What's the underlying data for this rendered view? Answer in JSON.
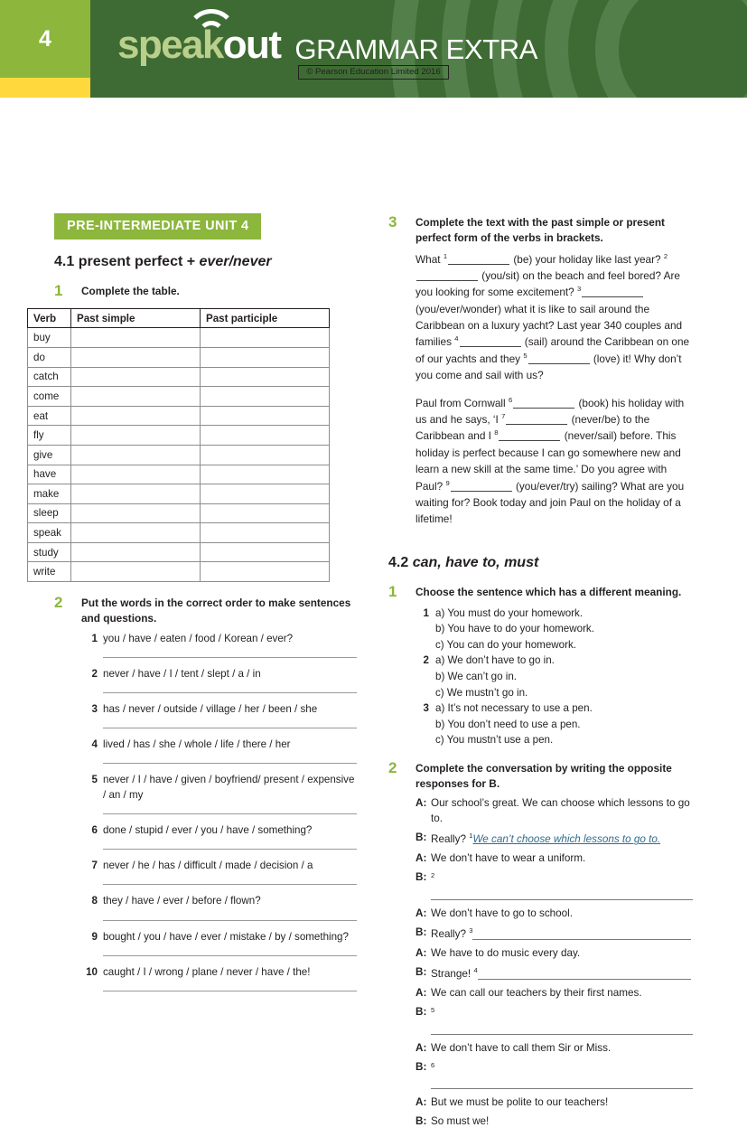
{
  "header": {
    "unit_number": "4",
    "logo_part1": "speak",
    "logo_part2": "out",
    "title": "GRAMMAR EXTRA",
    "colors": {
      "dark_green": "#3e6b33",
      "arc_green": "#53804a",
      "lime": "#8cb63c",
      "yellow": "#ffd83d"
    }
  },
  "left": {
    "banner": "PRE-INTERMEDIATE UNIT 4",
    "grammar_heading": {
      "code": "4.1",
      "text_plain": "present perfect + ",
      "text_italic": "ever/never"
    },
    "ex1": {
      "number": "1",
      "rubric": "Complete the table.",
      "table": {
        "headers": [
          "Verb",
          "Past simple",
          "Past participle"
        ],
        "rows": [
          [
            "buy",
            "",
            ""
          ],
          [
            "do",
            "",
            ""
          ],
          [
            "catch",
            "",
            ""
          ],
          [
            "come",
            "",
            ""
          ],
          [
            "eat",
            "",
            ""
          ],
          [
            "fly",
            "",
            ""
          ],
          [
            "give",
            "",
            ""
          ],
          [
            "have",
            "",
            ""
          ],
          [
            "make",
            "",
            ""
          ],
          [
            "sleep",
            "",
            ""
          ],
          [
            "speak",
            "",
            ""
          ],
          [
            "study",
            "",
            ""
          ],
          [
            "write",
            "",
            ""
          ]
        ]
      }
    },
    "ex2": {
      "number": "2",
      "rubric": "Put the words in the correct order to make sentences and questions.",
      "items": [
        {
          "n": "1",
          "text": "you / have / eaten / food / Korean / ever?"
        },
        {
          "n": "2",
          "text": "never / have / I / tent / slept / a / in"
        },
        {
          "n": "3",
          "text": "has / never / outside / village / her / been / she"
        },
        {
          "n": "4",
          "text": "lived / has / she / whole / life / there / her"
        },
        {
          "n": "5",
          "text": "never / I / have / given / boyfriend/ present / expensive / an / my"
        },
        {
          "n": "6",
          "text": "done / stupid / ever / you / have / something?"
        },
        {
          "n": "7",
          "text": "never / he / has / difficult / made / decision / a"
        },
        {
          "n": "8",
          "text": "they / have / ever / before / flown?"
        },
        {
          "n": "9",
          "text": "bought / you / have / ever / mistake / by / something?"
        },
        {
          "n": "10",
          "text": "caught / I / wrong / plane / never / have / the!"
        }
      ]
    }
  },
  "right": {
    "ex3": {
      "number": "3",
      "rubric": "Complete the text with the past simple or present perfect form of the verbs in brackets.",
      "paragraph1": [
        {
          "t": "text",
          "v": "What "
        },
        {
          "t": "sup",
          "v": "1"
        },
        {
          "t": "gap"
        },
        {
          "t": "text",
          "v": " (be) your holiday like last year? "
        },
        {
          "t": "sup",
          "v": "2"
        },
        {
          "t": "gap"
        },
        {
          "t": "text",
          "v": " (you/sit) on the beach and feel bored? Are you looking for some excitement? "
        },
        {
          "t": "sup",
          "v": "3"
        },
        {
          "t": "gap"
        },
        {
          "t": "text",
          "v": " (you/ever/wonder) what it is like to sail around the Caribbean on a luxury yacht? Last year 340 couples and families "
        },
        {
          "t": "sup",
          "v": "4"
        },
        {
          "t": "gap"
        },
        {
          "t": "text",
          "v": " (sail) around the Caribbean on one of our yachts and they "
        },
        {
          "t": "sup",
          "v": "5"
        },
        {
          "t": "gap"
        },
        {
          "t": "text",
          "v": " (love) it! Why don’t you come and sail with us?"
        }
      ],
      "paragraph2": [
        {
          "t": "text",
          "v": "Paul from Cornwall "
        },
        {
          "t": "sup",
          "v": "6"
        },
        {
          "t": "gap"
        },
        {
          "t": "text",
          "v": " (book) his holiday with us and he says, ‘I "
        },
        {
          "t": "sup",
          "v": "7"
        },
        {
          "t": "gap"
        },
        {
          "t": "text",
          "v": " (never/be) to the Caribbean and I "
        },
        {
          "t": "sup",
          "v": "8"
        },
        {
          "t": "gap"
        },
        {
          "t": "text",
          "v": " (never/sail) before. This holiday is perfect because I can go somewhere new and learn a new skill at the same time.’ Do you agree with Paul? "
        },
        {
          "t": "sup",
          "v": "9"
        },
        {
          "t": "gap"
        },
        {
          "t": "text",
          "v": " (you/ever/try) sailing? What are you waiting for? Book today and join Paul on the holiday of a lifetime!"
        }
      ]
    },
    "grammar_heading": {
      "code": "4.2",
      "text_italic": "can, have to, must"
    },
    "ex1": {
      "number": "1",
      "rubric": "Choose the sentence which has a different meaning.",
      "items": [
        {
          "n": "1",
          "options": [
            "a) You must do your homework.",
            "b) You have to do your homework.",
            "c) You can do your homework."
          ]
        },
        {
          "n": "2",
          "options": [
            "a) We don’t have to go in.",
            "b) We can’t go in.",
            "c) We mustn’t go in."
          ]
        },
        {
          "n": "3",
          "options": [
            "a) It’s not necessary to use a pen.",
            "b) You don’t need to use a pen.",
            "c) You mustn’t use a pen."
          ]
        }
      ]
    },
    "ex2": {
      "number": "2",
      "rubric": "Complete the conversation by writing the opposite responses for B.",
      "lines": [
        {
          "speaker": "A:",
          "text": "Our school’s great. We can choose which lessons to go to.",
          "blank": false
        },
        {
          "speaker": "B:",
          "text": "Really? ",
          "sup": "1",
          "sample": "We can’t choose which lessons to go to.",
          "blank": false
        },
        {
          "speaker": "A:",
          "text": "We don’t have to wear a uniform.",
          "blank": false
        },
        {
          "speaker": "B:",
          "text": "",
          "sup": "2",
          "blank": true
        },
        {
          "speaker": "A:",
          "text": "We don’t have to go to school.",
          "blank": false
        },
        {
          "speaker": "B:",
          "text": "Really? ",
          "sup": "3",
          "blank": true
        },
        {
          "speaker": "A:",
          "text": "We have to do music every day.",
          "blank": false
        },
        {
          "speaker": "B:",
          "text": "Strange! ",
          "sup": "4",
          "blank": true
        },
        {
          "speaker": "A:",
          "text": "We can call our teachers by their first names.",
          "blank": false
        },
        {
          "speaker": "B:",
          "text": "",
          "sup": "5",
          "blank": true
        },
        {
          "speaker": "A:",
          "text": "We don’t have to call them Sir or Miss.",
          "blank": false
        },
        {
          "speaker": "B:",
          "text": "",
          "sup": "6",
          "blank": true
        },
        {
          "speaker": "A:",
          "text": "But we must be polite to our teachers!",
          "blank": false
        },
        {
          "speaker": "B:",
          "text": "So must we!",
          "blank": false
        }
      ]
    }
  },
  "footer": {
    "copyright": "© Pearson Education Limited 2016"
  }
}
